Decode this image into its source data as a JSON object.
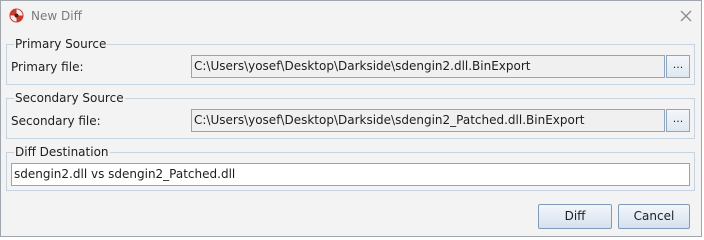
{
  "window": {
    "title": "New Diff",
    "close_icon": "close-icon",
    "app_icon": "bindiff-app-icon"
  },
  "primary": {
    "group_title": "Primary Source",
    "label": "Primary file:",
    "path": "C:\\Users\\yosef\\Desktop\\Darkside\\sdengin2.dll.BinExport",
    "browse_label": "..."
  },
  "secondary": {
    "group_title": "Secondary Source",
    "label": "Secondary file:",
    "path": "C:\\Users\\yosef\\Desktop\\Darkside\\sdengin2_Patched.dll.BinExport",
    "browse_label": "..."
  },
  "destination": {
    "group_title": "Diff Destination",
    "value": "sdengin2.dll vs sdengin2_Patched.dll"
  },
  "buttons": {
    "diff_label": "Diff",
    "cancel_label": "Cancel"
  }
}
